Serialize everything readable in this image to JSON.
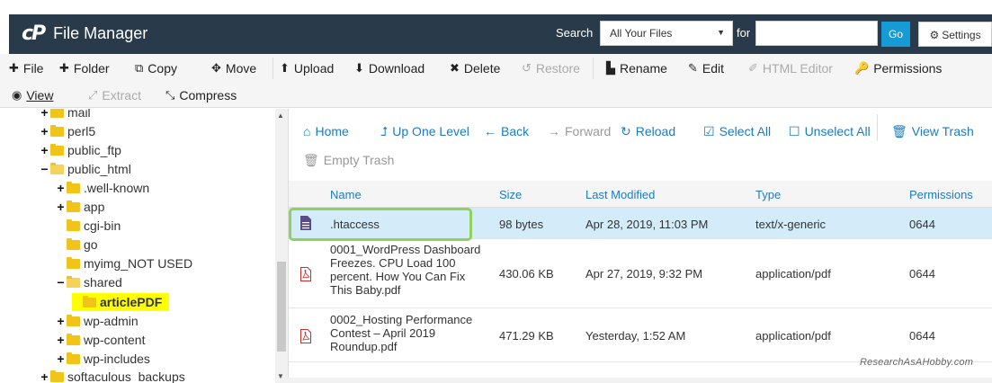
{
  "header": {
    "logo": "cP",
    "title": "File Manager",
    "search_label": "Search",
    "search_scope": "All Your Files",
    "for_label": "for",
    "search_value": "",
    "go_label": "Go",
    "settings_label": "Settings"
  },
  "toolbar": {
    "row1": [
      "File",
      "Folder",
      "Copy",
      "Move",
      "Upload",
      "Download",
      "Delete",
      "Restore",
      "Rename",
      "Edit",
      "HTML Editor",
      "Permissions"
    ],
    "row2": [
      "View",
      "Extract",
      "Compress"
    ]
  },
  "tree": {
    "nodes": [
      {
        "label": "mail",
        "toggle": "+"
      },
      {
        "label": "perl5",
        "toggle": "+"
      },
      {
        "label": "public_ftp",
        "toggle": "+"
      },
      {
        "label": "public_html",
        "toggle": "−"
      },
      {
        "label": ".well-known",
        "toggle": "+"
      },
      {
        "label": "app",
        "toggle": "+"
      },
      {
        "label": "cgi-bin",
        "toggle": ""
      },
      {
        "label": "go",
        "toggle": ""
      },
      {
        "label": "myimg_NOT USED",
        "toggle": ""
      },
      {
        "label": "shared",
        "toggle": "−"
      },
      {
        "label": "articlePDF",
        "toggle": ""
      },
      {
        "label": "wp-admin",
        "toggle": "+"
      },
      {
        "label": "wp-content",
        "toggle": "+"
      },
      {
        "label": "wp-includes",
        "toggle": "+"
      },
      {
        "label": "softaculous_backups",
        "toggle": "+"
      }
    ]
  },
  "nav": {
    "home": "Home",
    "up": "Up One Level",
    "back": "Back",
    "forward": "Forward",
    "reload": "Reload",
    "select_all": "Select All",
    "unselect_all": "Unselect All",
    "view_trash": "View Trash",
    "empty_trash": "Empty Trash"
  },
  "table": {
    "headers": {
      "name": "Name",
      "size": "Size",
      "modified": "Last Modified",
      "type": "Type",
      "perms": "Permissions"
    },
    "rows": [
      {
        "name": ".htaccess",
        "size": "98 bytes",
        "modified": "Apr 28, 2019, 11:03 PM",
        "type": "text/x-generic",
        "perms": "0644"
      },
      {
        "name_lines": [
          "0001_WordPress Dashboard",
          "Freezes. CPU Load 100",
          "percent. How You Can Fix",
          "This Baby.pdf"
        ],
        "size": "430.06 KB",
        "modified": "Apr 27, 2019, 9:32 PM",
        "type": "application/pdf",
        "perms": "0644"
      },
      {
        "name_lines": [
          "0002_Hosting Performance",
          "Contest – April 2019",
          "Roundup.pdf"
        ],
        "size": "471.29 KB",
        "modified": "Yesterday, 1:52 AM",
        "type": "application/pdf",
        "perms": "0644"
      }
    ]
  },
  "watermark": "ResearchAsAHobby.com",
  "colors": {
    "header_bg": "#293a4a",
    "link": "#1d7bbf",
    "go_button": "#179bd7",
    "selected_row": "#d4ecf9",
    "folder": "#f0c419",
    "highlight": "#8fd15e",
    "pdf_icon": "#c9302c"
  }
}
